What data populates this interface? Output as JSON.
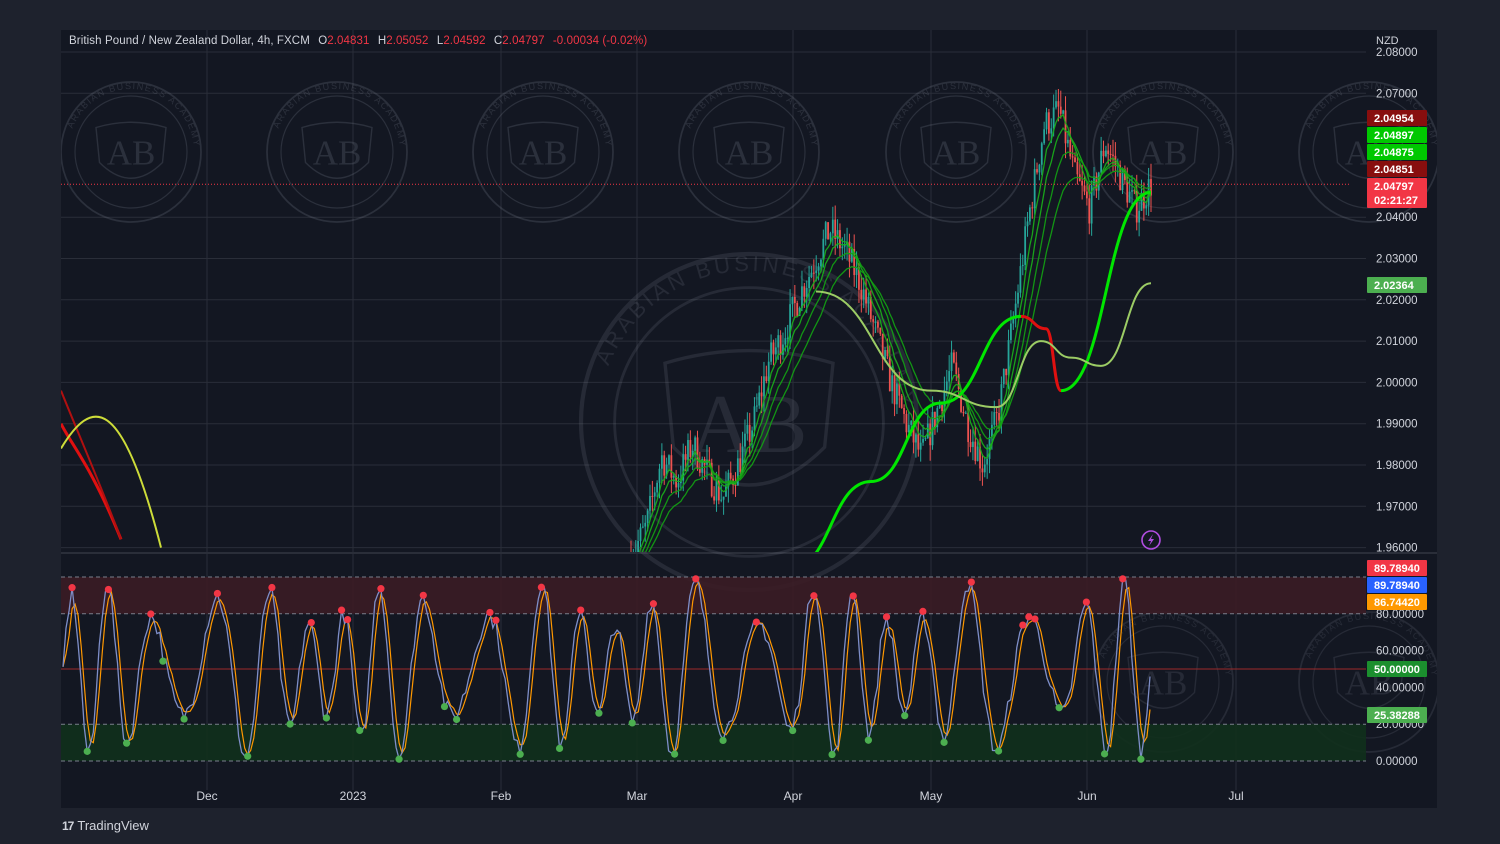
{
  "header": {
    "symbol": "British Pound / New Zealand Dollar, 4h, FXCM",
    "open_label": "O",
    "open": "2.04831",
    "high_label": "H",
    "high": "2.05052",
    "low_label": "L",
    "low": "2.04592",
    "close_label": "C",
    "close": "2.04797",
    "change": "-0.00034 (-0.02%)"
  },
  "brand": {
    "name": "TradingView"
  },
  "icons": {
    "lightning": "lightning-icon",
    "logo": "tradingview-logo-icon",
    "watermark": "academy-seal-icon"
  },
  "watermark": {
    "arc_text": "ARABIAN BUSINESS ACADEMY",
    "monogram": "AB"
  },
  "colors": {
    "background": "#131722",
    "frame": "#1e222d",
    "grid": "#2a2e39",
    "bull": "#26a69a",
    "bear": "#ef5350",
    "ma_green": "#00e600",
    "ma_red": "#e01010",
    "ma_light": "#9ccc65",
    "stoch_k": "#7e8ec8",
    "stoch_d": "#ff9800",
    "overbought_zone": "#3b1c25",
    "oversold_zone": "#11301c"
  },
  "chart_data": [
    {
      "type": "line",
      "panel": "price",
      "currency": "NZD",
      "x_ticks": [
        "Dec",
        "2023",
        "Feb",
        "Mar",
        "Apr",
        "May",
        "Jun",
        "Jul"
      ],
      "y_ticks": [
        "2.08000",
        "2.07000",
        "2.04000",
        "2.03000",
        "2.02000",
        "2.01000",
        "2.00000",
        "1.99000",
        "1.98000",
        "1.97000",
        "1.96000"
      ],
      "ylim": [
        1.957,
        2.081
      ],
      "close_sequence": [
        1.958,
        1.965,
        1.982,
        1.976,
        1.985,
        1.978,
        1.972,
        1.98,
        1.99,
        2.005,
        2.012,
        2.021,
        2.029,
        2.037,
        2.032,
        2.024,
        2.012,
        2.0,
        1.99,
        1.982,
        1.993,
        2.004,
        1.99,
        1.98,
        1.992,
        2.015,
        2.04,
        2.062,
        2.066,
        2.05,
        2.042,
        2.058,
        2.05,
        2.042,
        2.048
      ],
      "x_start_month": "Mar",
      "x_end_month": "Jun",
      "ma_lines": [
        {
          "color": "light",
          "values": [
            2.022,
            1.998,
            1.994,
            2.01,
            2.006,
            2.004,
            2.024
          ]
        },
        {
          "color": "green-red",
          "values": [
            1.955,
            1.976,
            1.995,
            2.016,
            2.013,
            1.998,
            2.046
          ]
        }
      ],
      "price_labels": [
        {
          "value": "2.04954",
          "color": "#880e0e"
        },
        {
          "value": "2.04897",
          "color": "#00c800"
        },
        {
          "value": "2.04875",
          "color": "#00c800"
        },
        {
          "value": "2.04851",
          "color": "#880e0e"
        },
        {
          "value": "2.04797",
          "color": "#f23645"
        },
        {
          "value": "02:21:27",
          "color": "#f23645"
        },
        {
          "value": "2.02364",
          "color": "#4caf50"
        }
      ],
      "last_price_line": "2.04797",
      "countdown": "02:21:27"
    },
    {
      "type": "line",
      "panel": "stochastic",
      "y_ticks": [
        "80.00000",
        "60.00000",
        "40.00000",
        "20.00000",
        "0.00000"
      ],
      "ylim": [
        0,
        100
      ],
      "overbought": 80,
      "middle": 50,
      "oversold": 20,
      "series": [
        {
          "name": "",
          "color": "#7e8ec8",
          "last": "89.78940"
        },
        {
          "name": "",
          "color": "#ff9800",
          "last": "86.74420"
        }
      ],
      "value_labels": [
        {
          "value": "89.78940",
          "color": "#f23645"
        },
        {
          "value": "89.78940",
          "color": "#2962ff"
        },
        {
          "value": "86.74420",
          "color": "#ff9800"
        },
        {
          "value": "50.00000",
          "color": "#1b8f2e"
        },
        {
          "value": "25.38288",
          "color": "#4caf50"
        }
      ]
    }
  ]
}
